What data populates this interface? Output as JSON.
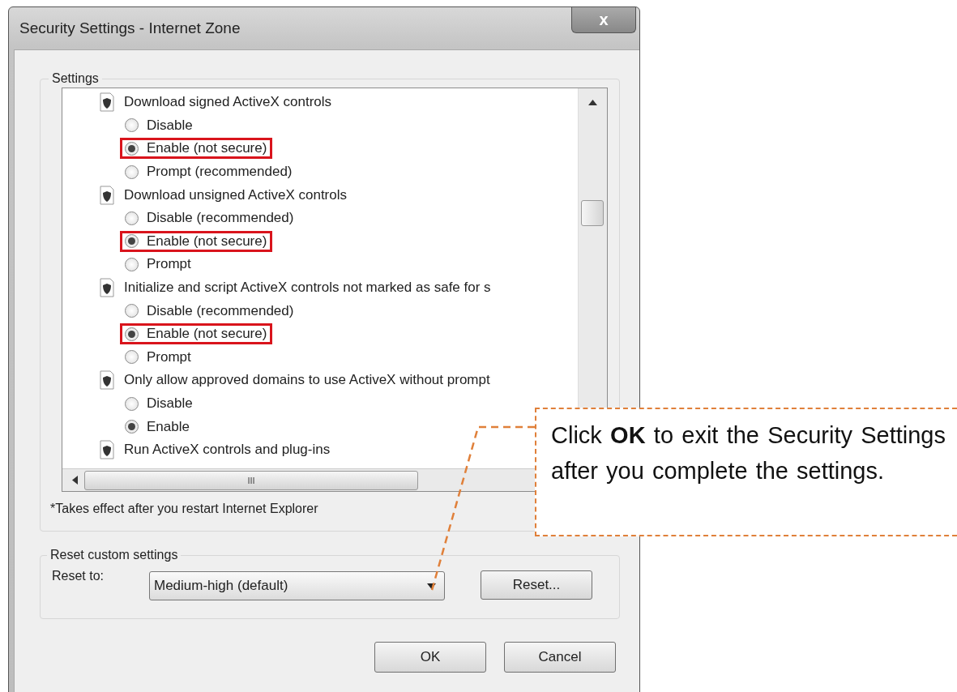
{
  "window": {
    "title": "Security Settings - Internet Zone",
    "close_label": "x"
  },
  "settings": {
    "title": "Settings",
    "groups": [
      {
        "label": "Download signed ActiveX controls",
        "options": [
          {
            "label": "Disable",
            "selected": false,
            "highlighted": false
          },
          {
            "label": "Enable (not secure)",
            "selected": true,
            "highlighted": true
          },
          {
            "label": "Prompt (recommended)",
            "selected": false,
            "highlighted": false
          }
        ]
      },
      {
        "label": "Download unsigned ActiveX controls",
        "options": [
          {
            "label": "Disable (recommended)",
            "selected": false,
            "highlighted": false
          },
          {
            "label": "Enable (not secure)",
            "selected": true,
            "highlighted": true
          },
          {
            "label": "Prompt",
            "selected": false,
            "highlighted": false
          }
        ]
      },
      {
        "label": "Initialize and script ActiveX controls not marked as safe for s",
        "options": [
          {
            "label": "Disable (recommended)",
            "selected": false,
            "highlighted": false
          },
          {
            "label": "Enable (not secure)",
            "selected": true,
            "highlighted": true
          },
          {
            "label": "Prompt",
            "selected": false,
            "highlighted": false
          }
        ]
      },
      {
        "label": "Only allow approved domains to use ActiveX without prompt",
        "options": [
          {
            "label": "Disable",
            "selected": false,
            "highlighted": false
          },
          {
            "label": "Enable",
            "selected": true,
            "highlighted": false
          }
        ]
      },
      {
        "label": "Run ActiveX controls and plug-ins"
      }
    ],
    "hscroll_grip": "III",
    "note": "*Takes effect after you restart Internet Explorer"
  },
  "reset": {
    "title": "Reset custom settings",
    "label": "Reset to:",
    "value": "Medium-high (default)",
    "button": "Reset..."
  },
  "buttons": [
    "OK",
    "Cancel"
  ],
  "callout": {
    "text": "Click **OK** to exit the Security Settings after you complete the settings."
  }
}
